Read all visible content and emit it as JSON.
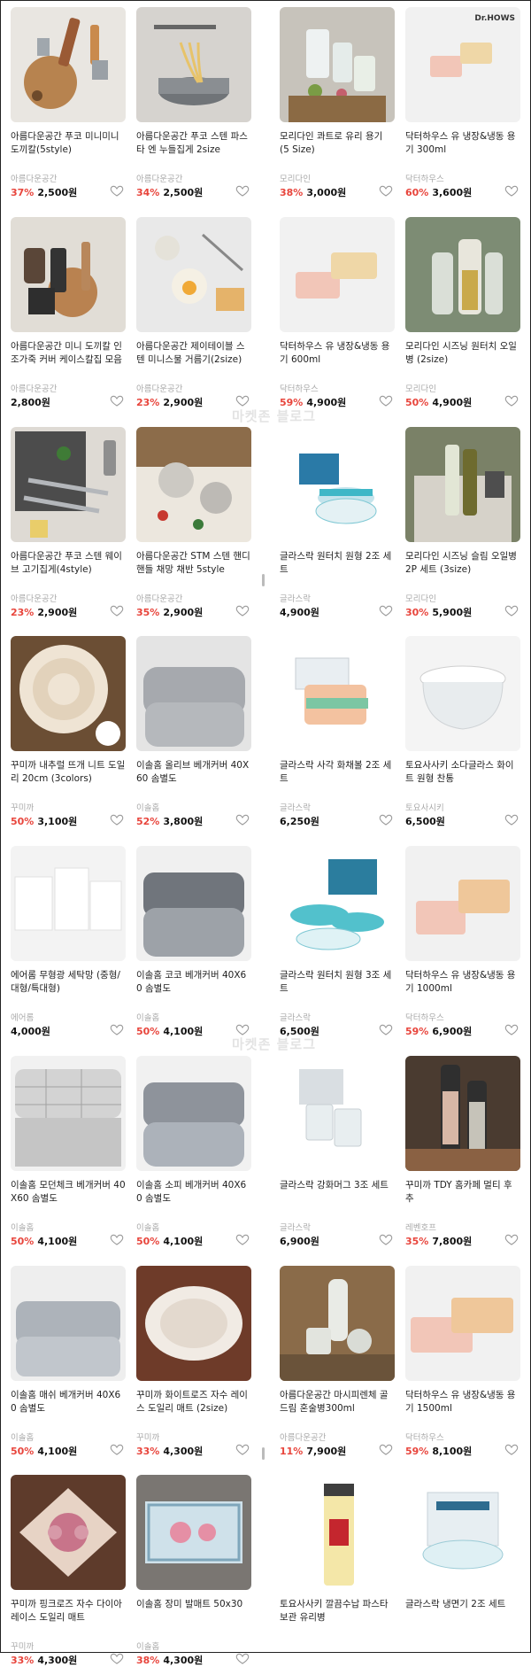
{
  "watermarks": [
    "마켓존 블로그",
    "마켓존 블로그"
  ],
  "logo_text": "Dr.HOWS",
  "products": [
    {
      "title": "아름다운공간 푸코 미니미니 도끼칼(5style)",
      "brand": "아름다운공간",
      "discount": "37%",
      "price": "2,500원",
      "thumb": "knives-board"
    },
    {
      "title": "아름다운공간 푸코 스텐 파스타 엔 누들집게 2size",
      "brand": "아름다운공간",
      "discount": "34%",
      "price": "2,500원",
      "thumb": "pasta-pot"
    },
    {
      "title": "모리다인 콰트로 유리 용기 (5 Size)",
      "brand": "모리다인",
      "discount": "38%",
      "price": "3,000원",
      "thumb": "glass-jars"
    },
    {
      "title": "닥터하우스 유 냉장&냉동 용기 300ml",
      "brand": "닥터하우스",
      "discount": "60%",
      "price": "3,600원",
      "thumb": "container-300"
    },
    {
      "title": "아름다운공간 미니 도끼칼 인조가죽 커버 케이스칼집 모음",
      "brand": "아름다운공간",
      "discount": "",
      "price": "2,800원",
      "thumb": "knife-cases"
    },
    {
      "title": "아름다운공간 제이테이블 스텐 미니스물 거름기(2size)",
      "brand": "아름다운공간",
      "discount": "23%",
      "price": "2,900원",
      "thumb": "strainer-egg"
    },
    {
      "title": "닥터하우스 유 냉장&냉동 용기 600ml",
      "brand": "닥터하우스",
      "discount": "59%",
      "price": "4,900원",
      "thumb": "container-600"
    },
    {
      "title": "모리다인 시즈닝 원터치 오일병 (2size)",
      "brand": "모리다인",
      "discount": "50%",
      "price": "4,900원",
      "thumb": "oil-bottles"
    },
    {
      "title": "아름다운공간 푸코 스텐 웨이브 고기집게(4style)",
      "brand": "아름다운공간",
      "discount": "23%",
      "price": "2,900원",
      "thumb": "tongs"
    },
    {
      "title": "아름다운공간 STM 스텐 핸디 핸들 채망 채반 5style",
      "brand": "아름다운공간",
      "discount": "35%",
      "price": "2,900원",
      "thumb": "sieves"
    },
    {
      "title": "글라스락 원터치 원형 2조 세트",
      "brand": "글라스락",
      "discount": "",
      "price": "4,900원",
      "thumb": "glasslock-round2"
    },
    {
      "title": "모리다인 시즈닝 슬림 오일병 2P 세트 (3size)",
      "brand": "모리다인",
      "discount": "30%",
      "price": "5,900원",
      "thumb": "slim-oil"
    },
    {
      "title": "꾸미까 내추럴 뜨개 니트 도일리 20cm (3colors)",
      "brand": "꾸미까",
      "discount": "50%",
      "price": "3,100원",
      "thumb": "doily-knit"
    },
    {
      "title": "이솔홈 올리브 베개커버 40X60 솜별도",
      "brand": "이솔홈",
      "discount": "52%",
      "price": "3,800원",
      "thumb": "pillow-olive"
    },
    {
      "title": "글라스락 사각 화채볼 2조 세트",
      "brand": "글라스락",
      "discount": "",
      "price": "6,250원",
      "thumb": "glasslock-square"
    },
    {
      "title": "토요사사키 소다글라스 화이트 원형 찬통",
      "brand": "토요사시키",
      "discount": "",
      "price": "6,500원",
      "thumb": "soda-glass"
    },
    {
      "title": "에어롬 무형광 세탁망 (중형/대형/특대형)",
      "brand": "에어롬",
      "discount": "",
      "price": "4,000원",
      "thumb": "laundry-net"
    },
    {
      "title": "이솔홈 코코 베개커버 40X60 솜별도",
      "brand": "이솔홈",
      "discount": "50%",
      "price": "4,100원",
      "thumb": "pillow-coco"
    },
    {
      "title": "글라스락 원터치 원형 3조 세트",
      "brand": "글라스락",
      "discount": "",
      "price": "6,500원",
      "thumb": "glasslock-round3"
    },
    {
      "title": "닥터하우스 유 냉장&냉동 용기 1000ml",
      "brand": "닥터하우스",
      "discount": "59%",
      "price": "6,900원",
      "thumb": "container-1000"
    },
    {
      "title": "이솔홈 모던체크 베개커버 40X60 솜별도",
      "brand": "이솔홈",
      "discount": "50%",
      "price": "4,100원",
      "thumb": "pillow-check"
    },
    {
      "title": "이솔홈 소피 베개커버 40X60 솜별도",
      "brand": "이솔홈",
      "discount": "50%",
      "price": "4,100원",
      "thumb": "pillow-sofi"
    },
    {
      "title": "글라스락 강화머그 3조 세트",
      "brand": "글라스락",
      "discount": "",
      "price": "6,900원",
      "thumb": "mugs"
    },
    {
      "title": "꾸미까 TDY 홈카페 멀티 후추",
      "brand": "레벤호프",
      "discount": "35%",
      "price": "7,800원",
      "thumb": "pepper-mill"
    },
    {
      "title": "이솔홈 매쉬 베개커버 40X60 솜별도",
      "brand": "이솔홈",
      "discount": "50%",
      "price": "4,100원",
      "thumb": "pillow-mesh"
    },
    {
      "title": "꾸미까 화이트로즈 자수 레이스 도일리 매트 (2size)",
      "brand": "꾸미까",
      "discount": "33%",
      "price": "4,300원",
      "thumb": "lace-white"
    },
    {
      "title": "아름다운공간 마시피렌체 골드림 혼술병300ml",
      "brand": "아름다운공간",
      "discount": "11%",
      "price": "7,900원",
      "thumb": "sake-bottle"
    },
    {
      "title": "닥터하우스 유 냉장&냉동 용기 1500ml",
      "brand": "닥터하우스",
      "discount": "59%",
      "price": "8,100원",
      "thumb": "container-1500"
    },
    {
      "title": "꾸미까 핑크로즈 자수 다이아 레이스 도일리 매트",
      "brand": "꾸미까",
      "discount": "33%",
      "price": "4,300원",
      "thumb": "lace-pink"
    },
    {
      "title": "이솔홈 장미 발매트 50x30",
      "brand": "이솔홈",
      "discount": "38%",
      "price": "4,300원",
      "thumb": "rose-mat"
    },
    {
      "title": "토요사사키 깔끔수납 파스타 보관 유리병",
      "brand": "",
      "discount": "",
      "price": "",
      "thumb": "pasta-jar"
    },
    {
      "title": "글라스락 냉면기 2조 세트",
      "brand": "",
      "discount": "",
      "price": "",
      "thumb": "glasslock-bowl"
    }
  ]
}
